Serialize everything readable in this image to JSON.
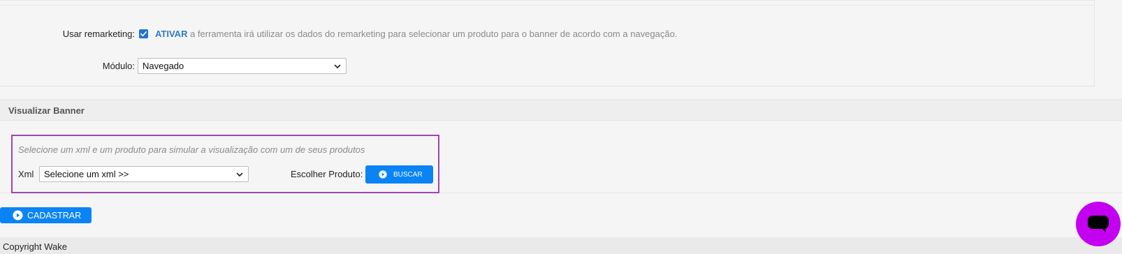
{
  "settings": {
    "remarketing_label": "Usar remarketing:",
    "remarketing_checked": true,
    "ativar_label": "ATIVAR",
    "remarketing_description": " a ferramenta irá utilizar os dados do remarketing para selecionar um produto para o banner de acordo com a navegação.",
    "modulo_label": "Módulo:",
    "modulo_value": "Navegado"
  },
  "visualizar": {
    "title": "Visualizar Banner",
    "description": "Selecione um xml e um produto para simular a visualização com um de seus produtos",
    "xml_label": "Xml",
    "xml_value": "Selecione um xml >>",
    "escolher_label": "Escolher Produto:",
    "buscar_label": "BUSCAR"
  },
  "actions": {
    "cadastrar_label": "CADASTRAR"
  },
  "footer": {
    "copyright": "Copyright Wake"
  },
  "colors": {
    "accent": "#0a84f5",
    "highlight_border": "#a044b0",
    "chat": "#c400f0",
    "ativar": "#2e7bc4"
  },
  "icons": {
    "checkbox": "check-icon",
    "select": "chevron-down-icon",
    "buttons": "play-circle-icon",
    "chat": "chat-bubble-icon"
  }
}
